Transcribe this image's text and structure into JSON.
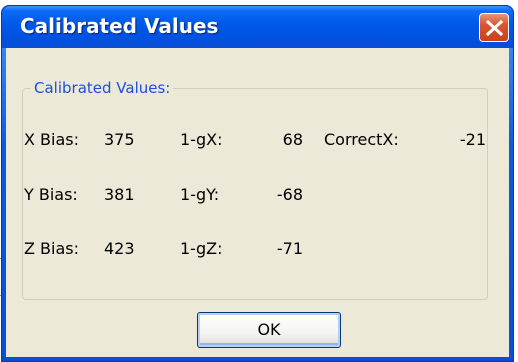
{
  "window": {
    "title": "Calibrated Values"
  },
  "group": {
    "title": "Calibrated Values:"
  },
  "rows": [
    {
      "bias_label": "X Bias:",
      "bias_value": "375",
      "g_label": "1-gX:",
      "g_value": "68",
      "correct_label": "CorrectX:",
      "correct_value": "-21"
    },
    {
      "bias_label": "Y Bias:",
      "bias_value": "381",
      "g_label": "1-gY:",
      "g_value": "-68"
    },
    {
      "bias_label": "Z Bias:",
      "bias_value": "423",
      "g_label": "1-gZ:",
      "g_value": "-71"
    }
  ],
  "buttons": {
    "ok_label": "OK"
  },
  "icons": {
    "close": "close-icon"
  },
  "colors": {
    "titlebar": "#0058e8",
    "client": "#ece9d8",
    "close_button": "#d8552d",
    "group_title": "#1f4fd6"
  }
}
